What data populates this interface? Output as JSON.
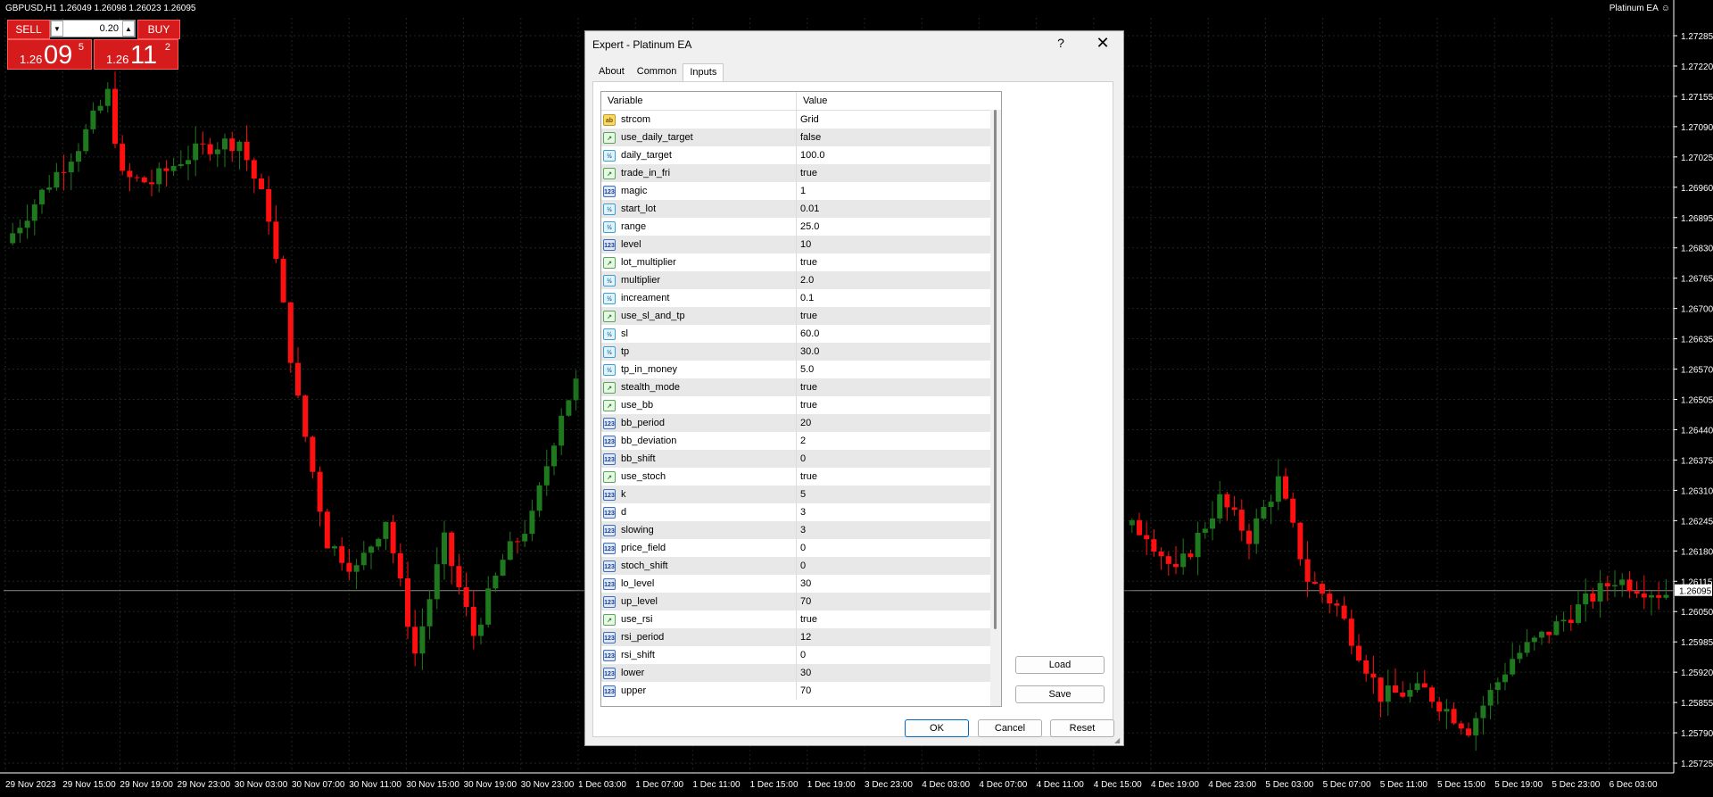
{
  "chart": {
    "symbol_line": "GBPUSD,H1  1.26049 1.26098 1.26023 1.26095",
    "ea_label": "Platinum EA",
    "ea_face": "☺",
    "price_labels": [
      "1.27285",
      "1.27220",
      "1.27155",
      "1.27090",
      "1.27025",
      "1.26960",
      "1.26895",
      "1.26830",
      "1.26765",
      "1.26700",
      "1.26635",
      "1.26570",
      "1.26505",
      "1.26440",
      "1.26375",
      "1.26310",
      "1.26245",
      "1.26180",
      "1.26115",
      "1.26050",
      "1.25985",
      "1.25920",
      "1.25855",
      "1.25790",
      "1.25725"
    ],
    "current_price": "1.26095",
    "time_labels": [
      "29 Nov 2023",
      "29 Nov 15:00",
      "29 Nov 19:00",
      "29 Nov 23:00",
      "30 Nov 03:00",
      "30 Nov 07:00",
      "30 Nov 11:00",
      "30 Nov 15:00",
      "30 Nov 19:00",
      "30 Nov 23:00",
      "1 Dec 03:00",
      "1 Dec 07:00",
      "1 Dec 11:00",
      "1 Dec 15:00",
      "1 Dec 19:00",
      "3 Dec 23:00",
      "4 Dec 03:00",
      "4 Dec 07:00",
      "4 Dec 11:00",
      "4 Dec 15:00",
      "4 Dec 19:00",
      "4 Dec 23:00",
      "5 Dec 03:00",
      "5 Dec 07:00",
      "5 Dec 11:00",
      "5 Dec 15:00",
      "5 Dec 19:00",
      "5 Dec 23:00",
      "6 Dec 03:00"
    ],
    "colors": {
      "bull": "#1f7a1f",
      "bear": "#ff1010",
      "grid": "#1c2a1c",
      "axis": "#ffffff",
      "current_bg": "#ffffff"
    }
  },
  "trade_panel": {
    "sell_label": "SELL",
    "buy_label": "BUY",
    "lot": "0.20",
    "sell_prefix": "1.26",
    "sell_big": "09",
    "sell_sup": "5",
    "buy_prefix": "1.26",
    "buy_big": "11",
    "buy_sup": "2"
  },
  "dialog": {
    "title": "Expert - Platinum EA",
    "help": "?",
    "close": "✕",
    "tabs": [
      "About",
      "Common",
      "Inputs"
    ],
    "active_tab": "Inputs",
    "headers": {
      "variable": "Variable",
      "value": "Value"
    },
    "params": [
      {
        "name": "strcom",
        "value": "Grid",
        "type": "str",
        "icon": "ab"
      },
      {
        "name": "use_daily_target",
        "value": "false",
        "type": "bool",
        "icon": "↗"
      },
      {
        "name": "daily_target",
        "value": "100.0",
        "type": "dbl",
        "icon": "½"
      },
      {
        "name": "trade_in_fri",
        "value": "true",
        "type": "bool",
        "icon": "↗"
      },
      {
        "name": "magic",
        "value": "1",
        "type": "int",
        "icon": "123"
      },
      {
        "name": "start_lot",
        "value": "0.01",
        "type": "dbl",
        "icon": "½"
      },
      {
        "name": "range",
        "value": "25.0",
        "type": "dbl",
        "icon": "½"
      },
      {
        "name": "level",
        "value": "10",
        "type": "int",
        "icon": "123"
      },
      {
        "name": "lot_multiplier",
        "value": "true",
        "type": "bool",
        "icon": "↗"
      },
      {
        "name": "multiplier",
        "value": "2.0",
        "type": "dbl",
        "icon": "½"
      },
      {
        "name": "increament",
        "value": "0.1",
        "type": "dbl",
        "icon": "½"
      },
      {
        "name": "use_sl_and_tp",
        "value": "true",
        "type": "bool",
        "icon": "↗"
      },
      {
        "name": "sl",
        "value": "60.0",
        "type": "dbl",
        "icon": "½"
      },
      {
        "name": "tp",
        "value": "30.0",
        "type": "dbl",
        "icon": "½"
      },
      {
        "name": "tp_in_money",
        "value": "5.0",
        "type": "dbl",
        "icon": "½"
      },
      {
        "name": "stealth_mode",
        "value": "true",
        "type": "bool",
        "icon": "↗"
      },
      {
        "name": "use_bb",
        "value": "true",
        "type": "bool",
        "icon": "↗"
      },
      {
        "name": "bb_period",
        "value": "20",
        "type": "int",
        "icon": "123"
      },
      {
        "name": "bb_deviation",
        "value": "2",
        "type": "int",
        "icon": "123"
      },
      {
        "name": "bb_shift",
        "value": "0",
        "type": "int",
        "icon": "123"
      },
      {
        "name": "use_stoch",
        "value": "true",
        "type": "bool",
        "icon": "↗"
      },
      {
        "name": "k",
        "value": "5",
        "type": "int",
        "icon": "123"
      },
      {
        "name": "d",
        "value": "3",
        "type": "int",
        "icon": "123"
      },
      {
        "name": "slowing",
        "value": "3",
        "type": "int",
        "icon": "123"
      },
      {
        "name": "price_field",
        "value": "0",
        "type": "int",
        "icon": "123"
      },
      {
        "name": "stoch_shift",
        "value": "0",
        "type": "int",
        "icon": "123"
      },
      {
        "name": "lo_level",
        "value": "30",
        "type": "int",
        "icon": "123"
      },
      {
        "name": "up_level",
        "value": "70",
        "type": "int",
        "icon": "123"
      },
      {
        "name": "use_rsi",
        "value": "true",
        "type": "bool",
        "icon": "↗"
      },
      {
        "name": "rsi_period",
        "value": "12",
        "type": "int",
        "icon": "123"
      },
      {
        "name": "rsi_shift",
        "value": "0",
        "type": "int",
        "icon": "123"
      },
      {
        "name": "lower",
        "value": "30",
        "type": "int",
        "icon": "123"
      },
      {
        "name": "upper",
        "value": "70",
        "type": "int",
        "icon": "123"
      }
    ],
    "buttons": {
      "load": "Load",
      "save": "Save",
      "ok": "OK",
      "cancel": "Cancel",
      "reset": "Reset"
    }
  }
}
